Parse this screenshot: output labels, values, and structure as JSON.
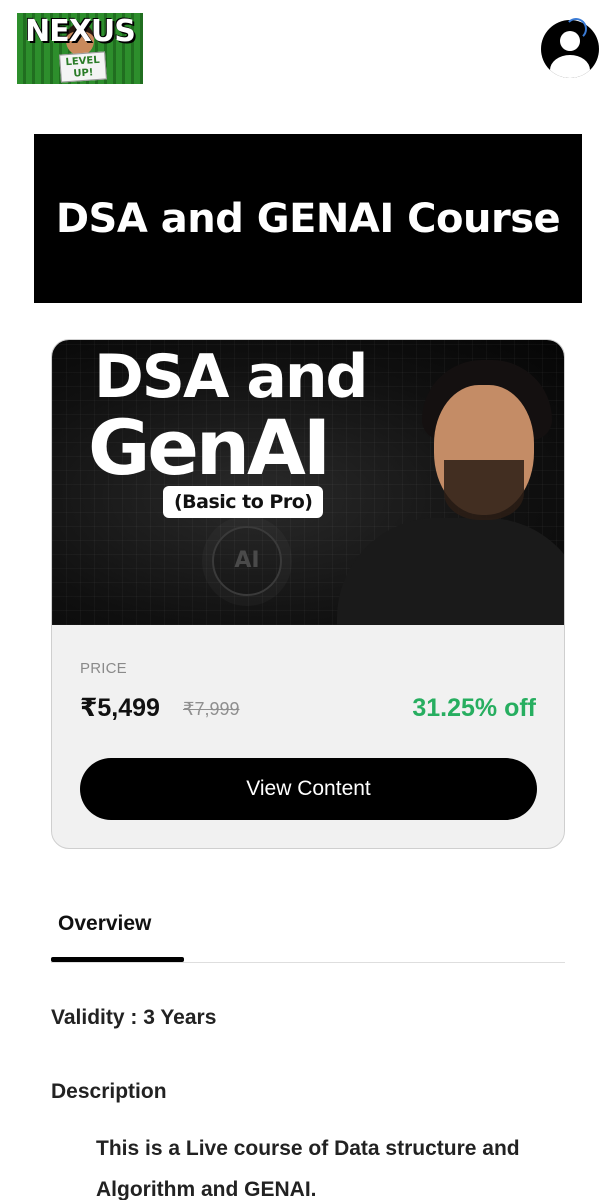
{
  "header": {
    "logo": {
      "brand": "NEXUS",
      "sign_text": "LEVEL UP!"
    },
    "profile_icon": "user-circle-icon"
  },
  "banner": {
    "title": "DSA and GENAI Course"
  },
  "course_card": {
    "thumbnail": {
      "line1": "DSA and",
      "line2": "GenAI",
      "tag": "(Basic to Pro)",
      "chip": "AI"
    },
    "price_label": "PRICE",
    "price_current": "₹5,499",
    "price_original": "₹7,999",
    "discount": "31.25% off",
    "view_button_label": "View Content"
  },
  "tabs": [
    {
      "label": "Overview",
      "active": true
    }
  ],
  "details": {
    "validity": "Validity : 3 Years",
    "description_heading": "Description",
    "description_text": "This is a Live course of Data structure and Algorithm and GENAI."
  },
  "colors": {
    "accent_discount": "#27ae60",
    "button_bg": "#000000",
    "banner_bg": "#000000"
  }
}
